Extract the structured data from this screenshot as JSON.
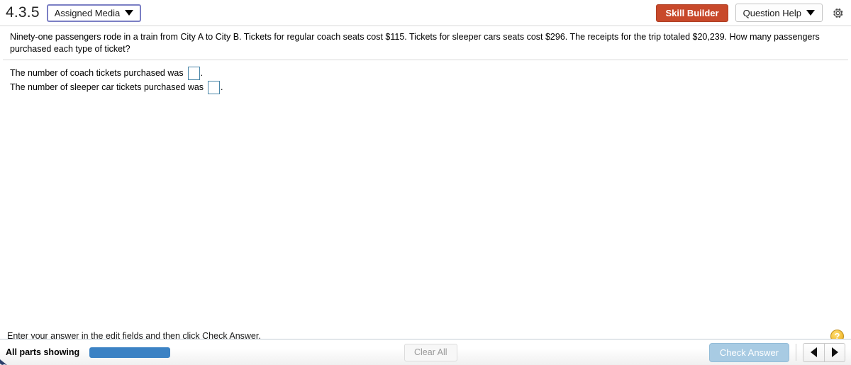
{
  "header": {
    "exercise_number": "4.3.5",
    "assigned_media_label": "Assigned Media",
    "skill_builder_label": "Skill Builder",
    "question_help_label": "Question Help",
    "gear_icon": "gear-icon",
    "skill_builder_color": "#c8492b",
    "assigned_media_border_color": "#7b7fc4"
  },
  "question": {
    "text": "Ninety-one passengers rode in a train from City A to City B. Tickets for regular coach seats cost $115. Tickets for sleeper cars seats cost $296. The receipts for the trip totaled $20,239. How many passengers purchased each type of ticket?"
  },
  "answers": {
    "lines": [
      {
        "prefix": "The number of coach tickets purchased was",
        "value": "",
        "suffix": "."
      },
      {
        "prefix": "The number of sleeper car tickets purchased was",
        "value": "",
        "suffix": "."
      }
    ],
    "input_border_color": "#4a86a8"
  },
  "hint": {
    "text": "Enter your answer in the edit fields and then click Check Answer.",
    "help_icon_label": "?",
    "help_icon_color": "#f5c13c"
  },
  "footer": {
    "parts_label": "All parts showing",
    "progress_percent": 100,
    "progress_color": "#3b82c4",
    "clear_all_label": "Clear All",
    "check_answer_label": "Check Answer",
    "check_answer_color": "#a8cbe3",
    "prev_icon": "triangle-left-icon",
    "next_icon": "triangle-right-icon"
  }
}
